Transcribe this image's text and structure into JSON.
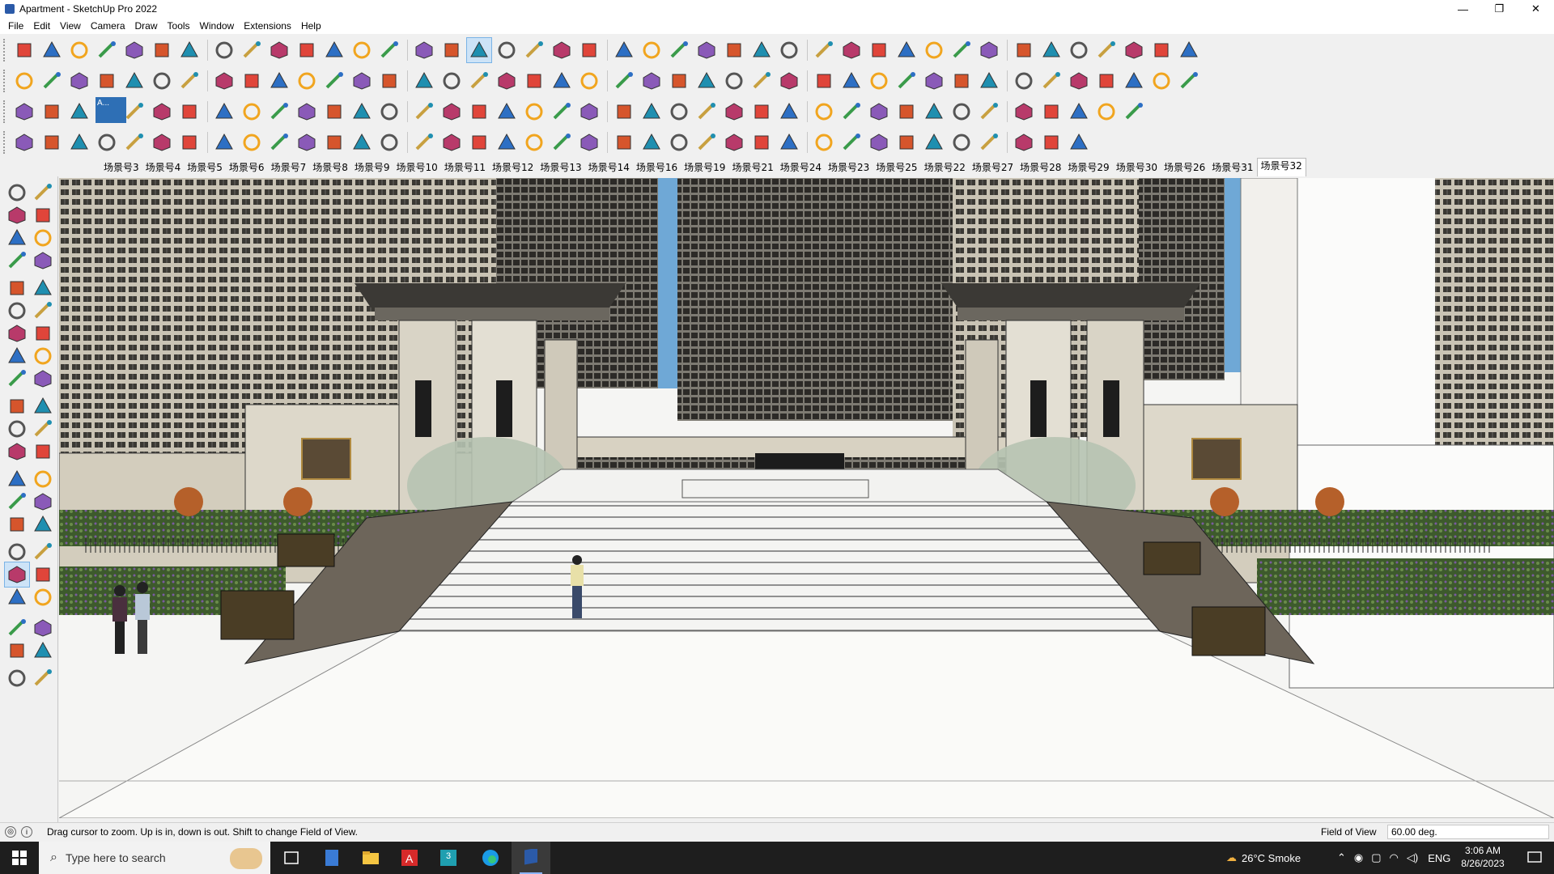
{
  "window": {
    "title": "Apartment - SketchUp Pro 2022",
    "minimize": "—",
    "maximize": "❐",
    "close": "✕"
  },
  "menu": [
    "File",
    "Edit",
    "View",
    "Camera",
    "Draw",
    "Tools",
    "Window",
    "Extensions",
    "Help"
  ],
  "scene_tabs": [
    "场景号3",
    "场景号4",
    "场景号5",
    "场景号6",
    "场景号7",
    "场景号8",
    "场景号9",
    "场景号10",
    "场景号11",
    "场景号12",
    "场景号13",
    "场景号14",
    "场景号16",
    "场景号19",
    "场景号21",
    "场景号24",
    "场景号23",
    "场景号25",
    "场景号22",
    "场景号27",
    "场景号28",
    "场景号29",
    "场景号30",
    "场景号26",
    "场景号31",
    "场景号32"
  ],
  "active_scene": "场景号32",
  "status": {
    "message": "Drag cursor to zoom.  Up is in, down is out. Shift to change Field of View.",
    "vcb_label": "Field of View",
    "vcb_value": "60.00 deg."
  },
  "taskbar": {
    "search_placeholder": "Type here to search",
    "weather": "26°C  Smoke",
    "language": "ENG",
    "time": "3:06 AM",
    "date": "8/26/2023",
    "excel_badge": "3"
  },
  "toolbar_popup_label": "A...",
  "colors": {
    "accent": "#2b5aa8",
    "selection": "#cde3f7",
    "taskbar": "#1e1e1e"
  }
}
